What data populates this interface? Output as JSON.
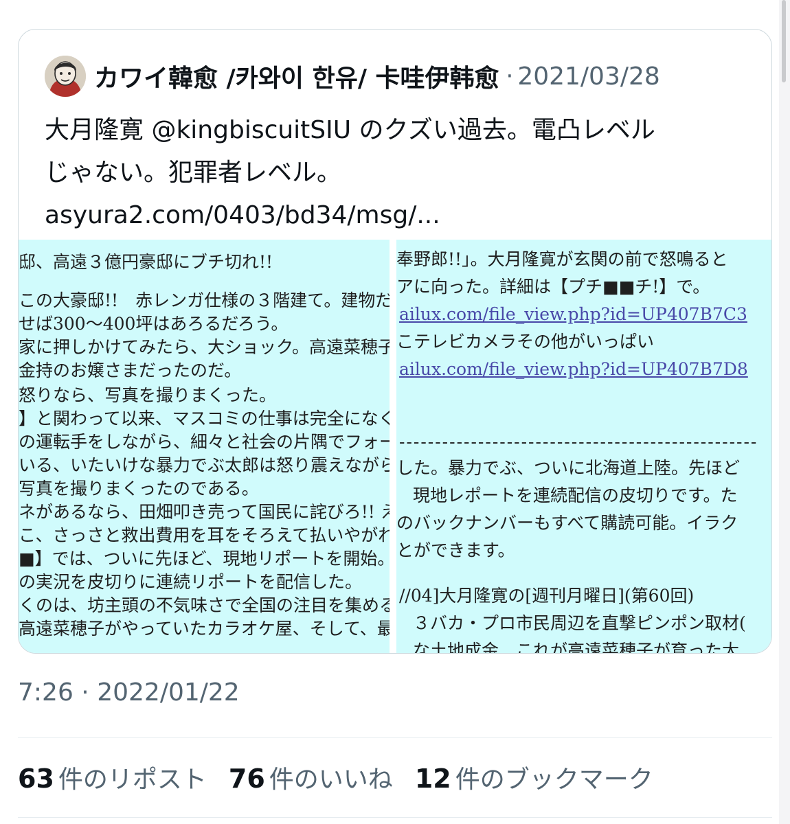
{
  "quote": {
    "author_name": "カワイ韓愈 /카와이 한유/ 卡哇伊韩愈",
    "separator": "·",
    "date": "2021/03/28",
    "text_lines": [
      "大月隆寛 @kingbiscuitSIU のクズい過去。電凸レベル",
      "じゃない。犯罪者レベル。",
      "asyura2.com/0403/bd34/msg/..."
    ],
    "image_left_lines": [
      "邸、高遠３億円豪邸にブチ切れ!!",
      "この大豪邸!!　赤レンガ仕様の３階建て。建物だけ",
      "せば300〜400坪はあろるだろう。",
      "家に押しかけてみたら、大ショック。高遠菜穂子は",
      "金持のお嬢さまだったのだ。",
      "怒りなら、写真を撮りまくった。",
      "】と関わって以来、マスコミの仕事は完全になく",
      "の運転手をしながら、細々と社会の片隅でフォーク",
      "いる、いたいけな暴力でぶ太郎は怒り震えながら、",
      "写真を撮りまくったのである。",
      "ネがあるなら、田畑叩き売って国民に詫びろ!! えら",
      "こ、さっさと救出費用を耳をそろえて払いやがれ!",
      "■】では、ついに先ほど、現地リポートを開始。大",
      "の実況を皮切りに連続リポートを配信した。",
      "くのは、坊主頭の不気味さで全国の注目を集める",
      "高遠菜穂子がやっていたカラオケ屋、そして、最後"
    ],
    "image_right_lines": [
      "奉野郎!!」。大月隆寛が玄関の前で怒鳴ると",
      "アに向った。詳細は【プチ■■チ!】で。",
      "ailux.com/file_view.php?id=UP407B7C3",
      "こテレビカメラその他がいっぱい",
      "ailux.com/file_view.php?id=UP407B7D8",
      "--------------------------------------------------",
      "した。暴力でぶ、ついに北海道上陸。先ほど",
      "現地レポートを連続配信の皮切りです。た",
      "のバックナンバーもすべて購読可能。イラク",
      "とができます。",
      "//04]大月隆寛の[週刊月曜日](第60回)",
      "３バカ・プロ市民周辺を直撃ピンポン取材(",
      "な土地成金　これが高遠菜穂子が育った大"
    ]
  },
  "post": {
    "time": "7:26",
    "separator": "·",
    "date": "2022/01/22"
  },
  "stats": {
    "reposts_count": "63",
    "reposts_label": "件のリポスト",
    "likes_count": "76",
    "likes_label": "件のいいね",
    "bookmarks_count": "12",
    "bookmarks_label": "件のブックマーク"
  },
  "colors": {
    "image_background": "#d0fbfc",
    "link_text": "#4848a8",
    "secondary_text": "#536471",
    "border": "#cfd9de"
  }
}
